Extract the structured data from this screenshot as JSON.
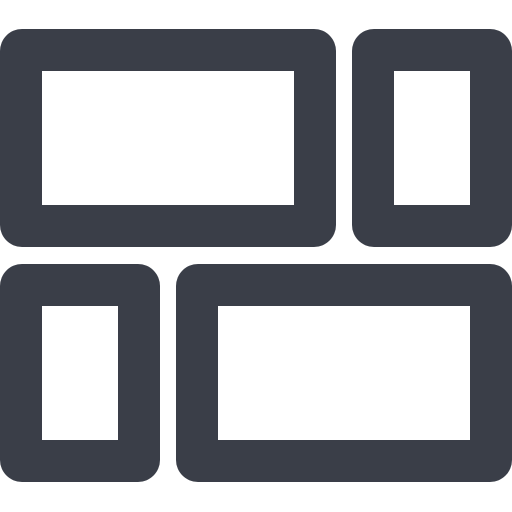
{
  "icon": {
    "name": "masonry-grid-icon",
    "color": "#3a3e48",
    "background": "#ffffff",
    "tiles": [
      {
        "name": "tile-top-wide"
      },
      {
        "name": "tile-top-narrow"
      },
      {
        "name": "tile-bottom-narrow"
      },
      {
        "name": "tile-bottom-wide"
      }
    ]
  }
}
